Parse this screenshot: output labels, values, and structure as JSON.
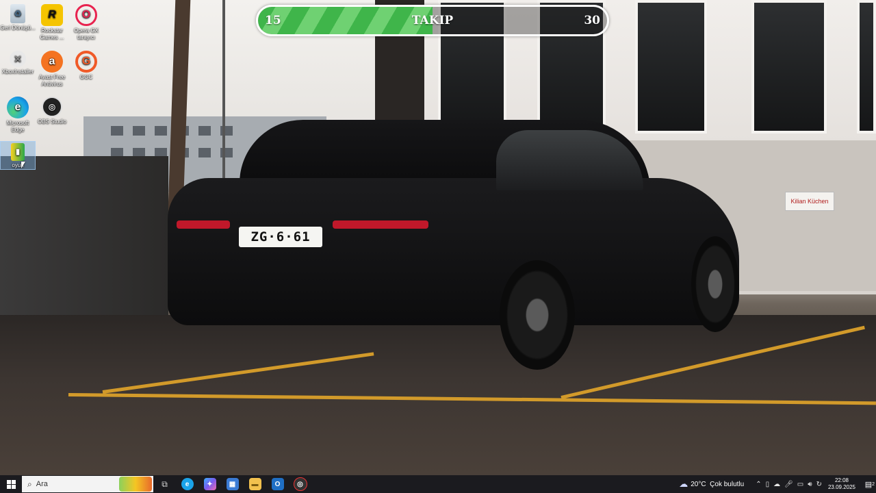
{
  "desktop_icons": [
    {
      "label": "Geri Dönüşü...",
      "icon": "recycle-bin-icon"
    },
    {
      "label": "Rockstar Games ...",
      "icon": "rockstar-games-icon"
    },
    {
      "label": "Opera GX tarayıcı",
      "icon": "opera-gx-icon"
    },
    {
      "label": "XboxInstaller",
      "icon": "xbox-icon"
    },
    {
      "label": "Avast Free Antivirus",
      "icon": "avast-icon"
    },
    {
      "label": "GGC",
      "icon": "ggc-icon"
    },
    {
      "label": "Microsoft Edge",
      "icon": "edge-icon"
    },
    {
      "label": "OBS Studio",
      "icon": "obs-icon"
    },
    {
      "label": "oyun",
      "icon": "game-icon"
    }
  ],
  "wallpaper": {
    "plate_text": "ZG·6·61",
    "sign_text": "Kilian Küchen"
  },
  "follow_goal": {
    "current": "15",
    "label": "TAKIP",
    "target": "30",
    "progress_fraction": 0.5,
    "fill_color": "#3fb54a"
  },
  "taskbar": {
    "search_placeholder": "Ara",
    "pinned": [
      {
        "name": "task-view",
        "icon": "task-view-icon"
      },
      {
        "name": "edge",
        "icon": "edge-icon",
        "color": "#1aa3e8"
      },
      {
        "name": "copilot",
        "icon": "copilot-icon",
        "color": "#7a5cf0"
      },
      {
        "name": "store",
        "icon": "store-icon",
        "color": "#3a7bd5"
      },
      {
        "name": "file-explorer",
        "icon": "folder-icon",
        "color": "#f2c14e"
      },
      {
        "name": "outlook",
        "icon": "outlook-icon",
        "color": "#1f6fc5"
      },
      {
        "name": "obs",
        "icon": "obs-icon",
        "color": "#444"
      }
    ],
    "weather": {
      "temp": "20°C",
      "condition": "Çok bulutlu"
    },
    "clock": {
      "time": "22:08",
      "date": "23.09.2025"
    },
    "notification_count": "2"
  }
}
